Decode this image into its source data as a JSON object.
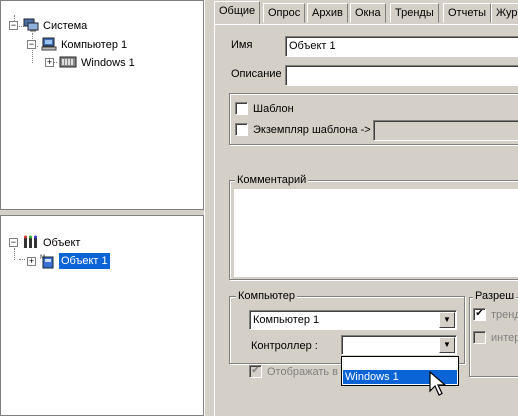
{
  "tree_top": {
    "items": [
      {
        "label": "Система"
      },
      {
        "label": "Компьютер 1"
      },
      {
        "label": "Windows 1"
      }
    ]
  },
  "tree_bottom": {
    "items": [
      {
        "label": "Объект"
      },
      {
        "label": "Объект 1"
      }
    ]
  },
  "tabs": [
    {
      "label": "Общие"
    },
    {
      "label": "Опрос"
    },
    {
      "label": "Архив"
    },
    {
      "label": "Окна"
    },
    {
      "label": "Тренды"
    },
    {
      "label": "Отчеты"
    },
    {
      "label": "Жур"
    }
  ],
  "form": {
    "name_label": "Имя",
    "name_value": "Объект 1",
    "description_label": "Описание",
    "description_value": "",
    "template_label": "Шаблон",
    "template_instance_label": "Экземпляр шаблона ->",
    "comment_title": "Комментарий",
    "computer_group_title": "Компьютер",
    "computer_value": "Компьютер 1",
    "controller_label": "Контроллер :",
    "controller_value": "",
    "dropdown_options": [
      "Windows 1"
    ],
    "show_in_label": "Отображать в",
    "permissions_title": "Разреш",
    "perm_trend_label": "тренд",
    "perm_inter_label": "интер"
  },
  "colors": {
    "selection": "#0a64d6",
    "background": "#d4d0c8"
  }
}
